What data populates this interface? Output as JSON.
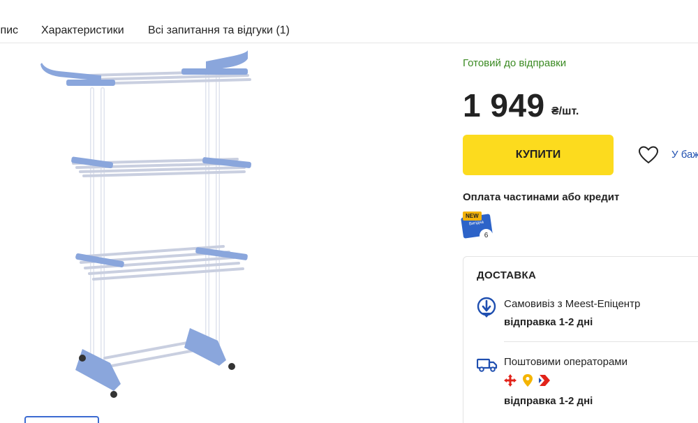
{
  "tabs": [
    {
      "label": "Опис"
    },
    {
      "label": "Характеристики"
    },
    {
      "label": "Всі запитання та відгуки (1)"
    }
  ],
  "product": {
    "image_alt": "Сушарка для білизни",
    "availability": "Готовий до відправки",
    "price": "1 949",
    "currency": "₴/шт.",
    "buy_label": "КУПИТИ",
    "wishlist_label": "У бажане"
  },
  "credit": {
    "title": "Оплата частинами або кредит",
    "badge_new": "NEW",
    "badge_card": "Вигідна",
    "badge_count": "6"
  },
  "delivery": {
    "title": "ДОСТАВКА",
    "options": [
      {
        "name": "Самовивіз з Meest-Епіцентр",
        "time": "відправка 1-2 дні",
        "icon": "pickup-pin-icon"
      },
      {
        "name": "Поштовими операторами",
        "time": "відправка 1-2 дні",
        "icon": "truck-icon"
      }
    ]
  },
  "colors": {
    "accent_yellow": "#fcdb1e",
    "available_green": "#3a8a22",
    "brand_blue": "#1f4fb0"
  }
}
